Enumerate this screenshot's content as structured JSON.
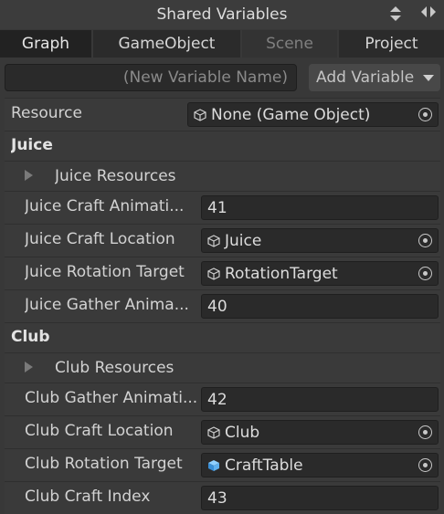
{
  "window": {
    "title": "Shared Variables"
  },
  "tabs": [
    {
      "label": "Graph"
    },
    {
      "label": "GameObject"
    },
    {
      "label": "Scene"
    },
    {
      "label": "Project"
    }
  ],
  "new_variable": {
    "placeholder": "(New Variable Name)",
    "add_label": "Add Variable"
  },
  "resource_row": {
    "label": "Resource",
    "value": "None (Game Object)"
  },
  "juice": {
    "header": "Juice",
    "foldout": "Juice Resources",
    "craft_animation": {
      "label": "Juice Craft Animati...",
      "value": "41"
    },
    "craft_location": {
      "label": "Juice Craft Location",
      "value": "Juice"
    },
    "rotation_target": {
      "label": "Juice Rotation Target",
      "value": "RotationTarget"
    },
    "gather_animation": {
      "label": "Juice Gather Anima...",
      "value": "40"
    }
  },
  "club": {
    "header": "Club",
    "foldout": "Club Resources",
    "gather_animation": {
      "label": "Club Gather Animati...",
      "value": "42"
    },
    "craft_location": {
      "label": "Club Craft Location",
      "value": "Club"
    },
    "rotation_target": {
      "label": "Club Rotation Target",
      "value": "CraftTable"
    },
    "craft_index": {
      "label": "Club Craft Index",
      "value": "43"
    }
  },
  "icons": [
    "arrows-up-down-icon",
    "arrows-left-right-icon",
    "gameobject-cube-icon",
    "prefab-cube-icon",
    "object-picker-icon",
    "foldout-arrow-icon",
    "dropdown-caret-icon"
  ]
}
